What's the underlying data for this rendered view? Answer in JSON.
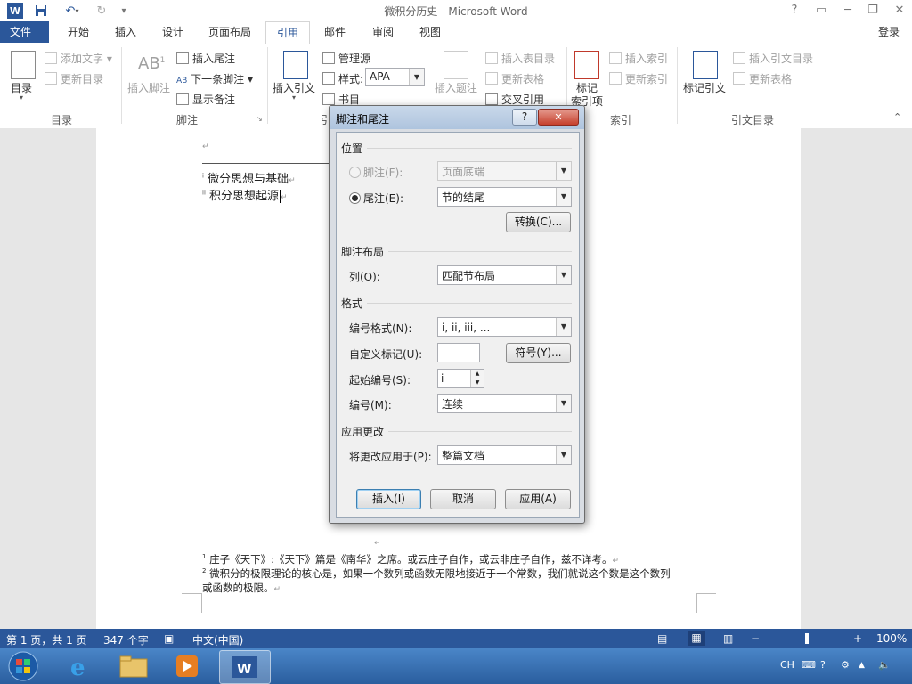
{
  "window": {
    "title": "微积分历史 - Microsoft Word",
    "login": "登录",
    "help": "?",
    "minimize": "─",
    "restore": "❐",
    "close": "✕"
  },
  "tabs": [
    "文件",
    "开始",
    "插入",
    "设计",
    "页面布局",
    "引用",
    "邮件",
    "审阅",
    "视图"
  ],
  "ribbon": {
    "toc": {
      "big": "目录",
      "add_text": "添加文字",
      "update": "更新目录",
      "group": "目录"
    },
    "footnotes": {
      "insert_footnote": "插入脚注",
      "insert_endnote": "插入尾注",
      "next_footnote": "下一条脚注",
      "show_notes": "显示备注",
      "group": "脚注",
      "ab_glyph": "AB",
      "ab_sup": "1",
      "ab1": "AB"
    },
    "citations": {
      "insert_citation": "插入引文",
      "manage_sources": "管理源",
      "style_label": "样式:",
      "style_value": "APA",
      "bibliography": "书目",
      "group": "引"
    },
    "captions": {
      "insert_caption": "插入题注",
      "insert_tof": "插入表目录",
      "update_table": "更新表格",
      "cross_ref": "交叉引用"
    },
    "index": {
      "mark_entry_1": "标记",
      "mark_entry_2": "索引项",
      "insert_index": "插入索引",
      "update_index": "更新索引",
      "group": "索引"
    },
    "toa": {
      "mark_citation": "标记引文",
      "insert_toa": "插入引文目录",
      "update_table": "更新表格",
      "group": "引文目录"
    }
  },
  "document": {
    "para_mark": "↵",
    "endnote1_num": "i",
    "endnote1_text": "微分思想与基础",
    "endnote2_num": "ii",
    "endnote2_text": "积分思想起源",
    "footnote1_num": "1",
    "footnote1_text": "庄子《天下》:《天下》篇是《南华》之席。或云庄子自作，或云非庄子自作，兹不详考。",
    "footnote2_num": "2",
    "footnote2_line1": "微积分的极限理论的核心是，如果一个数列或函数无限地接近于一个常数，我们就说这个数是这个数列",
    "footnote2_line2": "或函数的极限。"
  },
  "dialog": {
    "title": "脚注和尾注",
    "help": "?",
    "close": "✕",
    "location_section": "位置",
    "footnote_label": "脚注(F):",
    "footnote_value": "页面底端",
    "endnote_label": "尾注(E):",
    "endnote_value": "节的结尾",
    "convert_button": "转换(C)...",
    "layout_section": "脚注布局",
    "columns_label": "列(O):",
    "columns_value": "匹配节布局",
    "format_section": "格式",
    "number_format_label": "编号格式(N):",
    "number_format_value": "i, ii, iii, ...",
    "custom_mark_label": "自定义标记(U):",
    "custom_mark_value": "",
    "symbol_button": "符号(Y)...",
    "start_at_label": "起始编号(S):",
    "start_at_value": "i",
    "numbering_label": "编号(M):",
    "numbering_value": "连续",
    "apply_section": "应用更改",
    "apply_to_label": "将更改应用于(P):",
    "apply_to_value": "整篇文档",
    "insert_button": "插入(I)",
    "cancel_button": "取消",
    "apply_button": "应用(A)"
  },
  "statusbar": {
    "page": "第 1 页，共 1 页",
    "words": "347 个字",
    "language": "中文(中国)",
    "zoom": "100%",
    "zoom_fraction": 0.5
  },
  "taskbar": {
    "ime": "CH"
  },
  "colors": {
    "accent": "#2b579a"
  }
}
